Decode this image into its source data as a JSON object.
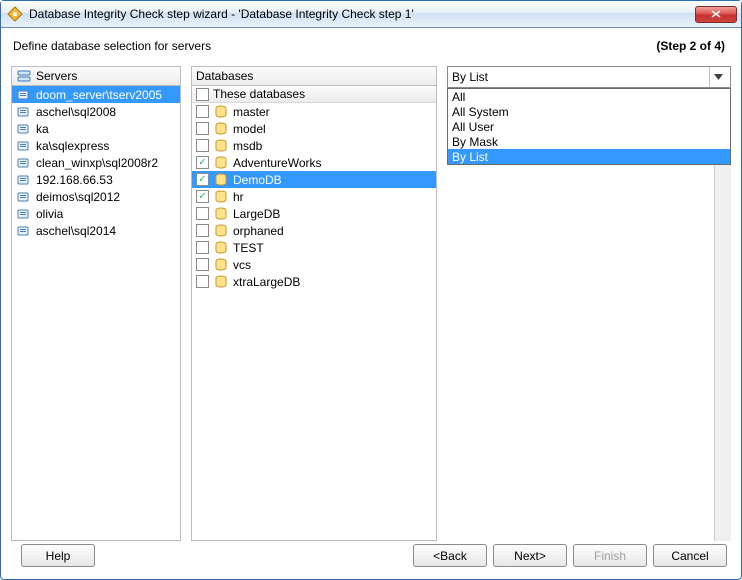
{
  "titlebar": {
    "title": "Database Integrity Check step wizard - 'Database Integrity Check step 1'"
  },
  "subhead": {
    "instruction": "Define database selection for servers",
    "step": "(Step 2 of 4)"
  },
  "servers": {
    "header": "Servers",
    "items": [
      {
        "label": "doom_server\\tserv2005",
        "selected": true
      },
      {
        "label": "aschel\\sql2008"
      },
      {
        "label": "ka"
      },
      {
        "label": "ka\\sqlexpress"
      },
      {
        "label": "clean_winxp\\sql2008r2"
      },
      {
        "label": "192.168.66.53"
      },
      {
        "label": "deimos\\sql2012"
      },
      {
        "label": "olivia"
      },
      {
        "label": "aschel\\sql2014"
      }
    ]
  },
  "databases": {
    "header": "Databases",
    "subheader": "These databases",
    "items": [
      {
        "label": "master",
        "checked": false
      },
      {
        "label": "model",
        "checked": false
      },
      {
        "label": "msdb",
        "checked": false
      },
      {
        "label": "AdventureWorks",
        "checked": true
      },
      {
        "label": "DemoDB",
        "checked": true,
        "selected": true
      },
      {
        "label": "hr",
        "checked": true
      },
      {
        "label": "LargeDB",
        "checked": false
      },
      {
        "label": "orphaned",
        "checked": false
      },
      {
        "label": "TEST",
        "checked": false
      },
      {
        "label": "vcs",
        "checked": false
      },
      {
        "label": "xtraLargeDB",
        "checked": false
      }
    ]
  },
  "combo": {
    "value": "By List",
    "options": [
      {
        "label": "All"
      },
      {
        "label": "All System"
      },
      {
        "label": "All User"
      },
      {
        "label": "By Mask"
      },
      {
        "label": "By List",
        "selected": true
      }
    ]
  },
  "buttons": {
    "help": "Help",
    "back": "<Back",
    "next": "Next>",
    "finish": "Finish",
    "cancel": "Cancel"
  }
}
